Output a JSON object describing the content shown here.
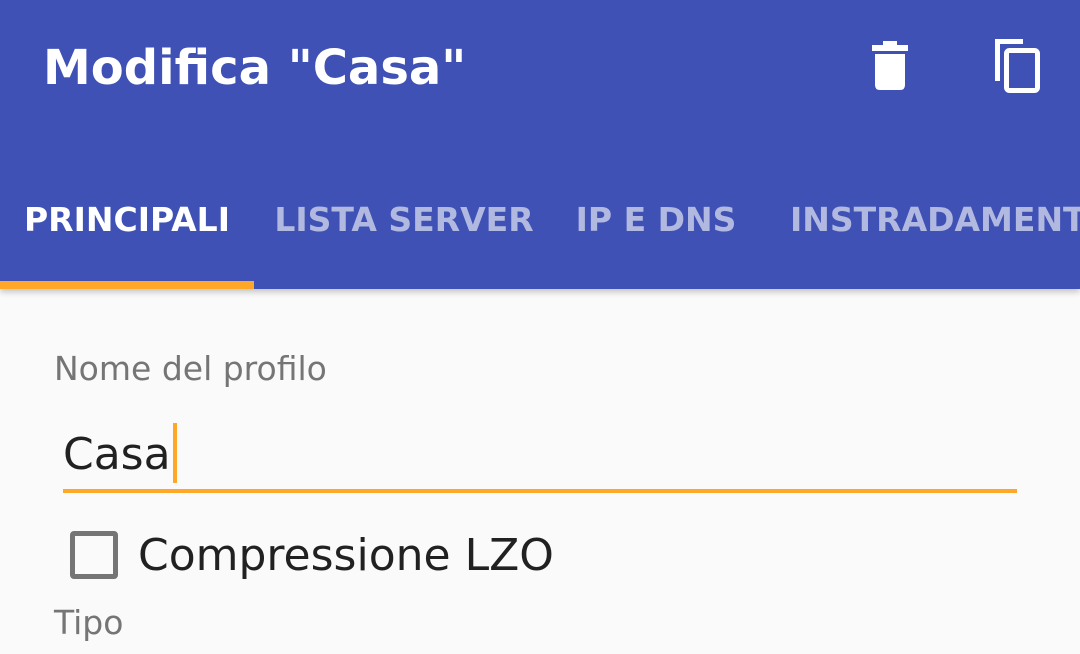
{
  "appbar": {
    "title": "Modifica \"Casa\"",
    "actions": [
      {
        "icon": "delete-icon",
        "label": "Elimina"
      },
      {
        "icon": "copy-icon",
        "label": "Copia"
      }
    ],
    "color": "#3f51b5"
  },
  "tabs": [
    {
      "label": "PRINCIPALI",
      "active": true
    },
    {
      "label": "LISTA SERVER",
      "active": false
    },
    {
      "label": "IP E DNS",
      "active": false
    },
    {
      "label": "INSTRADAMENTO",
      "active": false
    }
  ],
  "accent_color": "#ffa726",
  "form": {
    "profile_name_label": "Nome del profilo",
    "profile_name_value": "Casa",
    "lzo_checkbox_label": "Compressione LZO",
    "lzo_checked": false,
    "type_label": "Tipo"
  }
}
